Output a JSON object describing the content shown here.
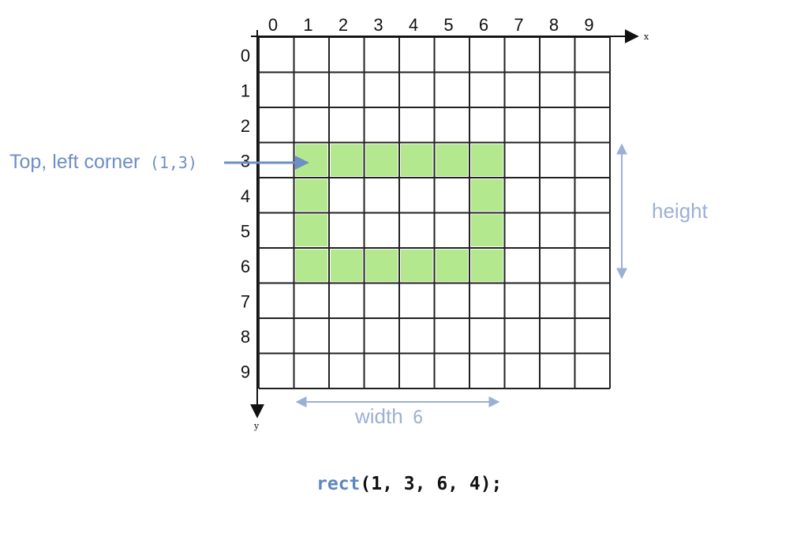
{
  "grid": {
    "columns": 10,
    "rows": 10,
    "x_ticks": [
      "0",
      "1",
      "2",
      "3",
      "4",
      "5",
      "6",
      "7",
      "8",
      "9"
    ],
    "y_ticks": [
      "0",
      "1",
      "2",
      "3",
      "4",
      "5",
      "6",
      "7",
      "8",
      "9"
    ],
    "x_axis_label": "x",
    "y_axis_label": "y",
    "filled_cells": [
      [
        1,
        3
      ],
      [
        2,
        3
      ],
      [
        3,
        3
      ],
      [
        4,
        3
      ],
      [
        5,
        3
      ],
      [
        6,
        3
      ],
      [
        1,
        4
      ],
      [
        6,
        4
      ],
      [
        1,
        5
      ],
      [
        6,
        5
      ],
      [
        1,
        6
      ],
      [
        2,
        6
      ],
      [
        3,
        6
      ],
      [
        4,
        6
      ],
      [
        5,
        6
      ],
      [
        6,
        6
      ]
    ],
    "colors": {
      "fill": "#b3e88f",
      "grid_line": "#222222",
      "annotation": "#6e8ec6",
      "annotation_soft": "#9bb0d6",
      "code_function": "#5b86c4"
    }
  },
  "annotations": {
    "corner_label": "Top, left corner",
    "corner_coords": "(1,3)",
    "height_label": "height",
    "width_label": "width",
    "width_value": "6"
  },
  "code": {
    "function_name": "rect",
    "arguments": "(1, 3, 6, 4);"
  }
}
